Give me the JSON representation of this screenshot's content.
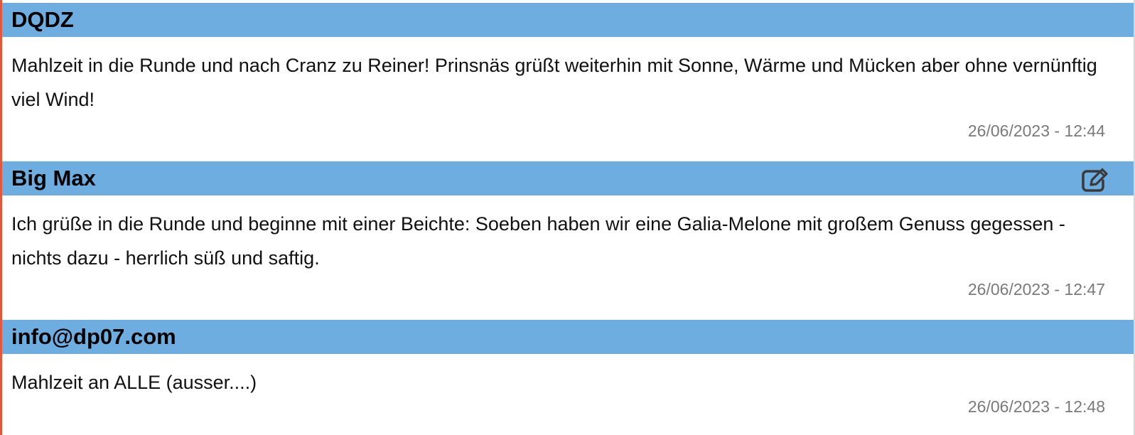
{
  "posts": [
    {
      "author": "DQDZ",
      "text": "Mahlzeit in die Runde und nach Cranz zu Reiner! Prinsnäs grüßt weiterhin mit Sonne, Wärme und Mücken aber ohne vernünftig viel Wind!",
      "timestamp": "26/06/2023 - 12:44",
      "editable": false
    },
    {
      "author": "Big Max",
      "text": "Ich grüße in die Runde und beginne mit einer Beichte: Soeben haben wir eine Galia-Melone mit großem Genuss gegessen - nichts dazu - herrlich süß und saftig.",
      "timestamp": "26/06/2023 - 12:47",
      "editable": true,
      "edit_icon": "edit-icon"
    },
    {
      "author": "info@dp07.com",
      "text": "Mahlzeit an ALLE (ausser....)",
      "timestamp": "26/06/2023 - 12:48",
      "editable": false
    }
  ],
  "colors": {
    "header_bg": "#6eaddf",
    "left_accent": "#e8563a",
    "timestamp": "#7a7a7a",
    "icon": "#3a3a3a"
  }
}
